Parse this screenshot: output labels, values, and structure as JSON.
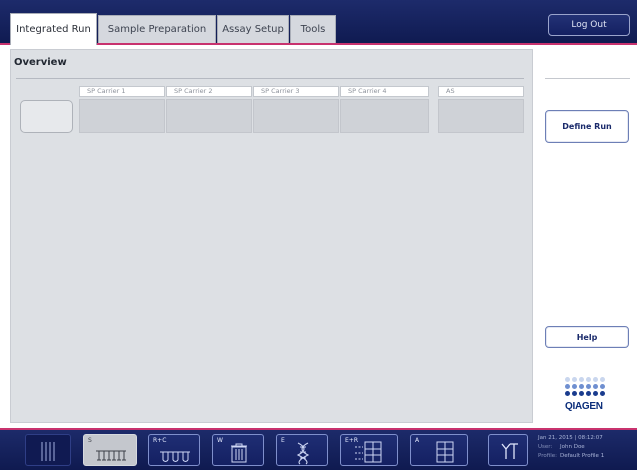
{
  "header": {
    "tabs": [
      {
        "label": "Integrated Run",
        "active": true
      },
      {
        "label": "Sample Preparation",
        "active": false
      },
      {
        "label": "Assay Setup",
        "active": false
      },
      {
        "label": "Tools",
        "active": false
      }
    ],
    "logout_label": "Log Out"
  },
  "overview": {
    "title": "Overview",
    "carriers": [
      "SP Carrier 1",
      "SP Carrier 2",
      "SP Carrier 3",
      "SP Carrier 4"
    ],
    "as_label": "AS"
  },
  "sidebar": {
    "define_run_label": "Define Run",
    "help_label": "Help",
    "logo_text": "QIAGEN"
  },
  "footer": {
    "buttons": [
      {
        "id": "tip-rack",
        "label": ""
      },
      {
        "id": "samples",
        "label": "S"
      },
      {
        "id": "reagents",
        "label": "R+C"
      },
      {
        "id": "waste",
        "label": "W"
      },
      {
        "id": "eluates",
        "label": "E"
      },
      {
        "id": "eluates-reagents",
        "label": "E+R"
      },
      {
        "id": "assays",
        "label": "A"
      },
      {
        "id": "tools",
        "label": ""
      }
    ],
    "status": {
      "datetime": "Jan 21, 2015 | 08:12:07",
      "user_label": "User:",
      "user": "John Doe",
      "profile_label": "Profile:",
      "profile": "Default Profile 1"
    }
  },
  "colors": {
    "header_bg": "#1d2b6b",
    "accent_pink": "#c8326e",
    "panel_bg": "#dde0e4",
    "button_text": "#1a2a6b",
    "qiagen_blue": "#0a2d7a"
  }
}
